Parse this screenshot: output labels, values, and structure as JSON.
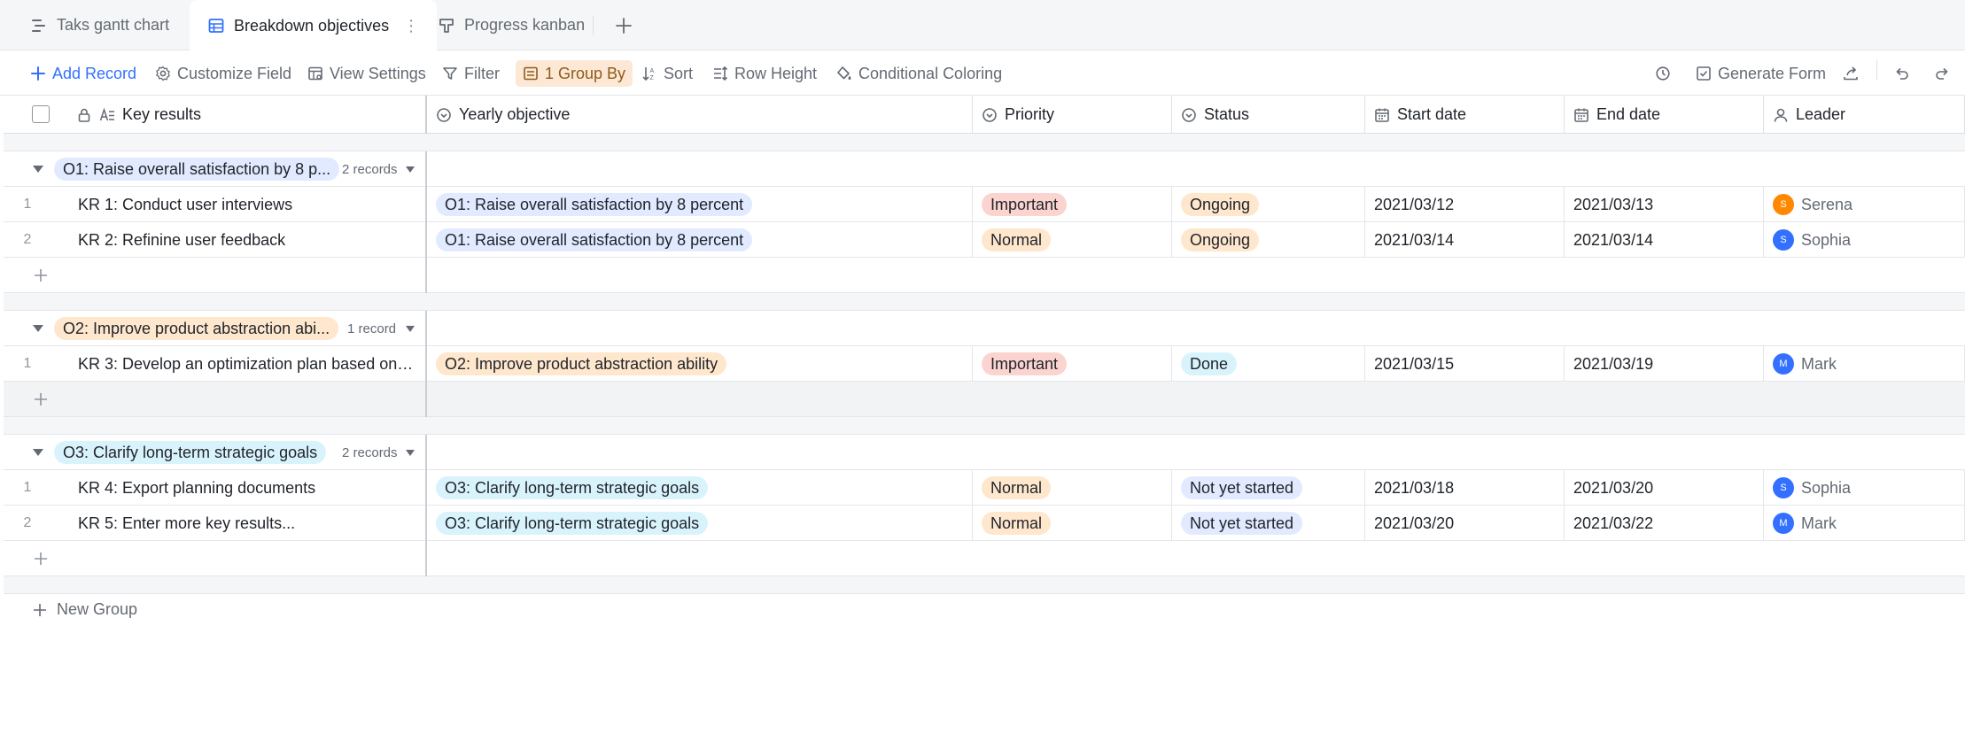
{
  "tabs": [
    {
      "label": "Taks gantt chart",
      "icon": "gantt-icon",
      "active": false
    },
    {
      "label": "Breakdown objectives",
      "icon": "grid-table-icon",
      "active": true
    },
    {
      "label": "Progress kanban",
      "icon": "kanban-icon",
      "active": false
    }
  ],
  "toolbar": {
    "add_record": "Add Record",
    "customize_field": "Customize Field",
    "view_settings": "View Settings",
    "filter": "Filter",
    "group_by": "1 Group By",
    "sort": "Sort",
    "row_height": "Row Height",
    "conditional_coloring": "Conditional Coloring",
    "generate_form": "Generate Form"
  },
  "columns": {
    "key_results": "Key results",
    "yearly_objective": "Yearly objective",
    "priority": "Priority",
    "status": "Status",
    "start_date": "Start date",
    "end_date": "End date",
    "leader": "Leader"
  },
  "groups": [
    {
      "label": "O1: Raise overall satisfaction by 8 p...",
      "count": "2 records",
      "color": "#e1eaff",
      "rows": [
        {
          "num": "1",
          "kr": "KR 1: Conduct user interviews",
          "objective": "O1: Raise overall satisfaction by 8 percent",
          "priority": "Important",
          "status": "Ongoing",
          "start": "2021/03/12",
          "end": "2021/03/13",
          "leader": "Serena",
          "initial": "S"
        },
        {
          "num": "2",
          "kr": "KR 2: Refinine user feedback",
          "objective": "O1: Raise overall satisfaction by 8 percent",
          "priority": "Normal",
          "status": "Ongoing",
          "start": "2021/03/14",
          "end": "2021/03/14",
          "leader": "Sophia",
          "initial": "S"
        }
      ]
    },
    {
      "label": "O2: Improve product abstraction abi...",
      "count": "1 record",
      "color": "#fee7cd",
      "rows": [
        {
          "num": "1",
          "kr": "KR 3: Develop an optimization plan based on u...",
          "objective": "O2: Improve product abstraction ability",
          "priority": "Important",
          "status": "Done",
          "start": "2021/03/15",
          "end": "2021/03/19",
          "leader": "Mark",
          "initial": "M"
        }
      ]
    },
    {
      "label": "O3: Clarify long-term strategic goals",
      "count": "2 records",
      "color": "#d9f3fd",
      "rows": [
        {
          "num": "1",
          "kr": "KR 4: Export planning documents",
          "objective": "O3: Clarify long-term strategic goals",
          "priority": "Normal",
          "status": "Not yet started",
          "start": "2021/03/18",
          "end": "2021/03/20",
          "leader": "Sophia",
          "initial": "S"
        },
        {
          "num": "2",
          "kr": "KR 5: Enter more key results...",
          "objective": "O3: Clarify long-term strategic goals",
          "priority": "Normal",
          "status": "Not yet started",
          "start": "2021/03/20",
          "end": "2021/03/22",
          "leader": "Mark",
          "initial": "M"
        }
      ]
    }
  ],
  "new_group": "New Group",
  "colors": {
    "accent": "#3370ff",
    "important": "#fbd4d0",
    "normal": "#fee7cd",
    "ongoing": "#fee7cd",
    "done": "#d9f3fd",
    "not_started": "#e1eaff",
    "avatar_serena": "#ff8800",
    "avatar_sophia": "#3370ff",
    "avatar_mark": "#3370ff"
  }
}
